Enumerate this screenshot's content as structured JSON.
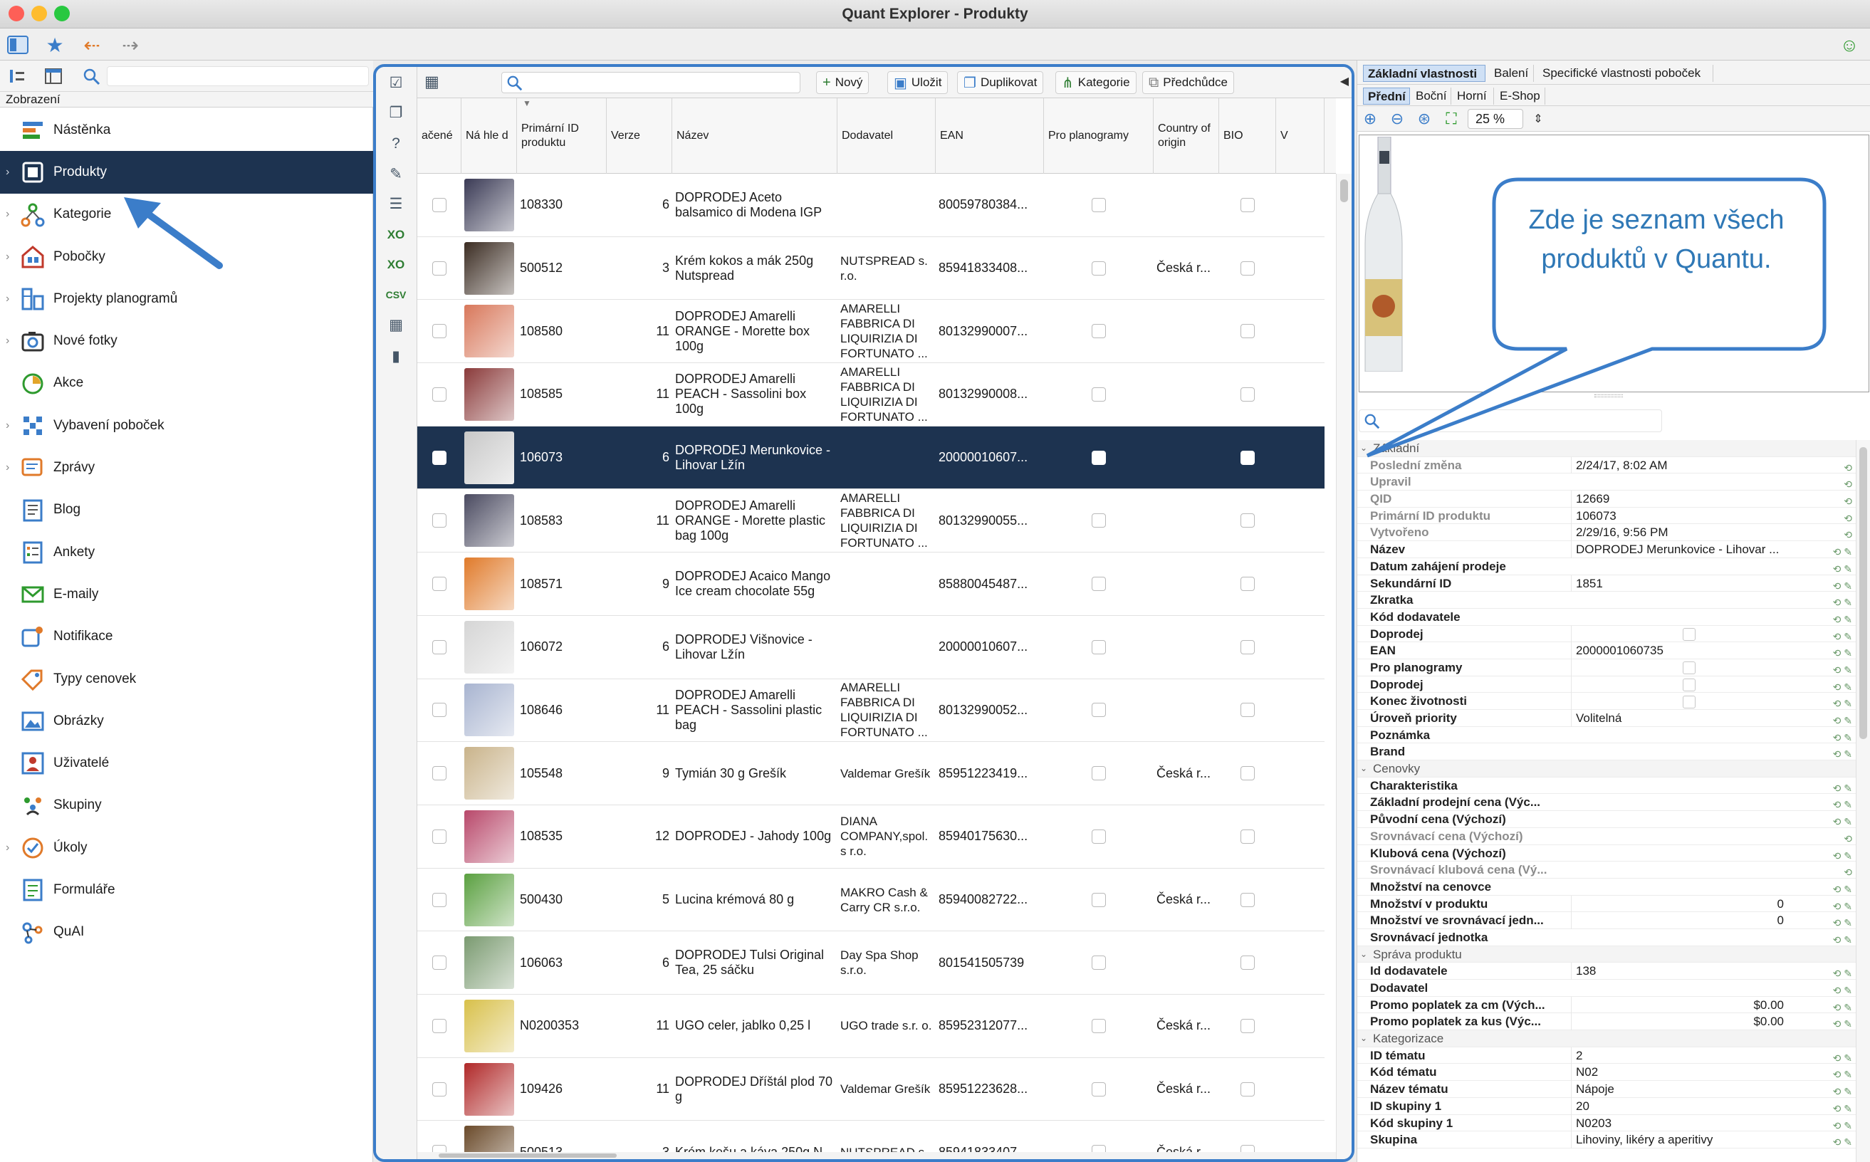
{
  "window": {
    "title": "Quant Explorer - Produkty"
  },
  "colors": {
    "accent": "#3b7dc9",
    "selected_bg": "#1d3350",
    "callout_text": "#2f78b6"
  },
  "sidebar": {
    "header": "Zobrazení",
    "items": [
      {
        "label": "Nástěnka",
        "icon": "dashboard-icon",
        "chevron": false
      },
      {
        "label": "Produkty",
        "icon": "product-icon",
        "chevron": true,
        "selected": true
      },
      {
        "label": "Kategorie",
        "icon": "category-tree-icon",
        "chevron": true
      },
      {
        "label": "Pobočky",
        "icon": "store-icon",
        "chevron": true
      },
      {
        "label": "Projekty planogramů",
        "icon": "planogram-icon",
        "chevron": true
      },
      {
        "label": "Nové fotky",
        "icon": "camera-icon",
        "chevron": true
      },
      {
        "label": "Akce",
        "icon": "promotion-icon",
        "chevron": false
      },
      {
        "label": "Vybavení poboček",
        "icon": "store-equipment-icon",
        "chevron": true
      },
      {
        "label": "Zprávy",
        "icon": "message-icon",
        "chevron": true
      },
      {
        "label": "Blog",
        "icon": "blog-icon",
        "chevron": false
      },
      {
        "label": "Ankety",
        "icon": "survey-icon",
        "chevron": false
      },
      {
        "label": "E-maily",
        "icon": "email-icon",
        "chevron": false
      },
      {
        "label": "Notifikace",
        "icon": "notification-icon",
        "chevron": false
      },
      {
        "label": "Typy cenovek",
        "icon": "price-tag-icon",
        "chevron": false
      },
      {
        "label": "Obrázky",
        "icon": "image-icon",
        "chevron": false
      },
      {
        "label": "Uživatelé",
        "icon": "user-icon",
        "chevron": false
      },
      {
        "label": "Skupiny",
        "icon": "group-icon",
        "chevron": false
      },
      {
        "label": "Úkoly",
        "icon": "task-icon",
        "chevron": true
      },
      {
        "label": "Formuláře",
        "icon": "form-icon",
        "chevron": false
      },
      {
        "label": "QuAI",
        "icon": "ai-icon",
        "chevron": false
      }
    ],
    "brand": "Quant"
  },
  "table_toolbar": {
    "new": "Nový",
    "save": "Uložit",
    "duplicate": "Duplikovat",
    "category": "Kategorie",
    "predecessor": "Předchůdce"
  },
  "table": {
    "columns": [
      "ačené",
      "Ná hle d",
      "Primární ID produktu",
      "Verze",
      "Název",
      "Dodavatel",
      "EAN",
      "Pro planogramy",
      "Country of origin",
      "BIO",
      "V"
    ],
    "rows": [
      {
        "id": "108330",
        "ver": "6",
        "name": "DOPRODEJ Aceto balsamico di Modena IGP",
        "supplier": "",
        "ean": "80059780384...",
        "origin": "",
        "thumb": "#3a3a55"
      },
      {
        "id": "500512",
        "ver": "3",
        "name": "Krém kokos a mák 250g Nutspread",
        "supplier": "NUTSPREAD s. r.o.",
        "ean": "85941833408...",
        "origin": "Česká r...",
        "thumb": "#3b2c22"
      },
      {
        "id": "108580",
        "ver": "11",
        "name": "DOPRODEJ Amarelli ORANGE - Morette box 100g",
        "supplier": "AMARELLI FABBRICA DI LIQUIRIZIA DI FORTUNATO ...",
        "ean": "80132990007...",
        "origin": "",
        "thumb": "#d8775a"
      },
      {
        "id": "108585",
        "ver": "11",
        "name": "DOPRODEJ Amarelli PEACH - Sassolini box 100g",
        "supplier": "AMARELLI FABBRICA DI LIQUIRIZIA DI FORTUNATO ...",
        "ean": "80132990008...",
        "origin": "",
        "thumb": "#8a3a3a"
      },
      {
        "id": "106073",
        "ver": "6",
        "name": "DOPRODEJ Merunkovice - Lihovar Lžín",
        "supplier": "",
        "ean": "20000010607...",
        "origin": "",
        "thumb": "#c8c8c8",
        "selected": true
      },
      {
        "id": "108583",
        "ver": "11",
        "name": "DOPRODEJ Amarelli ORANGE - Morette plastic bag 100g",
        "supplier": "AMARELLI FABBRICA DI LIQUIRIZIA DI FORTUNATO ...",
        "ean": "80132990055...",
        "origin": "",
        "thumb": "#4a4a60"
      },
      {
        "id": "108571",
        "ver": "9",
        "name": "DOPRODEJ Acaico Mango Ice cream chocolate 55g",
        "supplier": "",
        "ean": "85880045487...",
        "origin": "",
        "thumb": "#e07a2a"
      },
      {
        "id": "106072",
        "ver": "6",
        "name": "DOPRODEJ Višnovice - Lihovar Lžín",
        "supplier": "",
        "ean": "20000010607...",
        "origin": "",
        "thumb": "#d5d5d5"
      },
      {
        "id": "108646",
        "ver": "11",
        "name": "DOPRODEJ Amarelli PEACH - Sassolini plastic bag",
        "supplier": "AMARELLI FABBRICA DI LIQUIRIZIA DI FORTUNATO ...",
        "ean": "80132990052...",
        "origin": "",
        "thumb": "#a8b4d0"
      },
      {
        "id": "105548",
        "ver": "9",
        "name": "Tymián 30 g Grešík",
        "supplier": "Valdemar Grešík",
        "ean": "85951223419...",
        "origin": "Česká r...",
        "thumb": "#c9b38a"
      },
      {
        "id": "108535",
        "ver": "12",
        "name": "DOPRODEJ - Jahody 100g",
        "supplier": "DIANA COMPANY,spol. s r.o.",
        "ean": "85940175630...",
        "origin": "",
        "thumb": "#b8486a"
      },
      {
        "id": "500430",
        "ver": "5",
        "name": "Lucina krémová 80 g",
        "supplier": "MAKRO Cash & Carry CR s.r.o.",
        "ean": "85940082722...",
        "origin": "Česká r...",
        "thumb": "#5aa040"
      },
      {
        "id": "106063",
        "ver": "6",
        "name": "DOPRODEJ Tulsi Original Tea, 25 sáčku",
        "supplier": "Day Spa Shop s.r.o.",
        "ean": "801541505739",
        "origin": "",
        "thumb": "#7a9a70"
      },
      {
        "id": "N0200353",
        "ver": "11",
        "name": "UGO celer, jablko 0,25 l",
        "supplier": "UGO trade s.r. o.",
        "ean": "85952312077...",
        "origin": "Česká r...",
        "thumb": "#d8c04a"
      },
      {
        "id": "109426",
        "ver": "11",
        "name": "DOPRODEJ Dříštál plod 70 g",
        "supplier": "Valdemar Grešík",
        "ean": "85951223628...",
        "origin": "Česká r...",
        "thumb": "#b02828"
      },
      {
        "id": "500513",
        "ver": "3",
        "name": "Krém kešu a káva 250g N...",
        "supplier": "NUTSPREAD s.",
        "ean": "85941833407...",
        "origin": "Česká r...",
        "thumb": "#6a4a2a"
      }
    ]
  },
  "detail": {
    "tabs": [
      "Základní vlastnosti",
      "Balení",
      "Specifické vlastnosti poboček"
    ],
    "view_tabs": [
      "Přední",
      "Boční",
      "Horní",
      "E-Shop"
    ],
    "zoom": "25 %",
    "callout": "Zde je seznam všech produktů v Quantu.",
    "properties": [
      {
        "section": "Základní"
      },
      {
        "k": "Poslední změna",
        "v": "2/24/17, 8:02 AM",
        "dis": true
      },
      {
        "k": "Upravil",
        "v": "",
        "dis": true
      },
      {
        "k": "QID",
        "v": "12669",
        "dis": true
      },
      {
        "k": "Primární ID produktu",
        "v": "106073",
        "dis": true
      },
      {
        "k": "Vytvořeno",
        "v": "2/29/16, 9:56 PM",
        "dis": true
      },
      {
        "k": "Název",
        "v": "DOPRODEJ Merunkovice - Lihovar ..."
      },
      {
        "k": "Datum zahájení prodeje",
        "v": ""
      },
      {
        "k": "Sekundární ID",
        "v": "1851"
      },
      {
        "k": "Zkratka",
        "v": ""
      },
      {
        "k": "Kód dodavatele",
        "v": ""
      },
      {
        "k": "Doprodej",
        "v": "",
        "box": true
      },
      {
        "k": "EAN",
        "v": "2000001060735"
      },
      {
        "k": "Pro planogramy",
        "v": "",
        "box": true
      },
      {
        "k": "Doprodej",
        "v": "",
        "box": true
      },
      {
        "k": "Konec životnosti",
        "v": "",
        "box": true
      },
      {
        "k": "Úroveň priority",
        "v": "Volitelná"
      },
      {
        "k": "Poznámka",
        "v": ""
      },
      {
        "k": "Brand",
        "v": ""
      },
      {
        "section": "Cenovky"
      },
      {
        "k": "Charakteristika",
        "v": ""
      },
      {
        "k": "Základní prodejní cena (Výc...",
        "v": ""
      },
      {
        "k": "Původní cena (Výchozí)",
        "v": ""
      },
      {
        "k": "Srovnávací cena (Výchozí)",
        "v": "",
        "dis": true
      },
      {
        "k": "Klubová cena (Výchozí)",
        "v": ""
      },
      {
        "k": "Srovnávací klubová cena (Vý...",
        "v": "",
        "dis": true
      },
      {
        "k": "Množství na cenovce",
        "v": ""
      },
      {
        "k": "Množství v produktu",
        "v": "0",
        "num": true
      },
      {
        "k": "Množství ve srovnávací jedn...",
        "v": "0",
        "num": true
      },
      {
        "k": "Srovnávací jednotka",
        "v": ""
      },
      {
        "section": "Správa produktu"
      },
      {
        "k": "Id dodavatele",
        "v": "138"
      },
      {
        "k": "Dodavatel",
        "v": ""
      },
      {
        "k": "Promo poplatek za cm (Vých...",
        "v": "$0.00",
        "num": true
      },
      {
        "k": "Promo poplatek za kus (Výc...",
        "v": "$0.00",
        "num": true
      },
      {
        "section": "Kategorizace"
      },
      {
        "k": "ID tématu",
        "v": "2"
      },
      {
        "k": "Kód tématu",
        "v": "N02"
      },
      {
        "k": "Název tématu",
        "v": "Nápoje"
      },
      {
        "k": "ID skupiny 1",
        "v": "20"
      },
      {
        "k": "Kód skupiny 1",
        "v": "N0203"
      },
      {
        "k": "Skupina",
        "v": "Lihoviny, likéry a aperitivy"
      }
    ]
  }
}
